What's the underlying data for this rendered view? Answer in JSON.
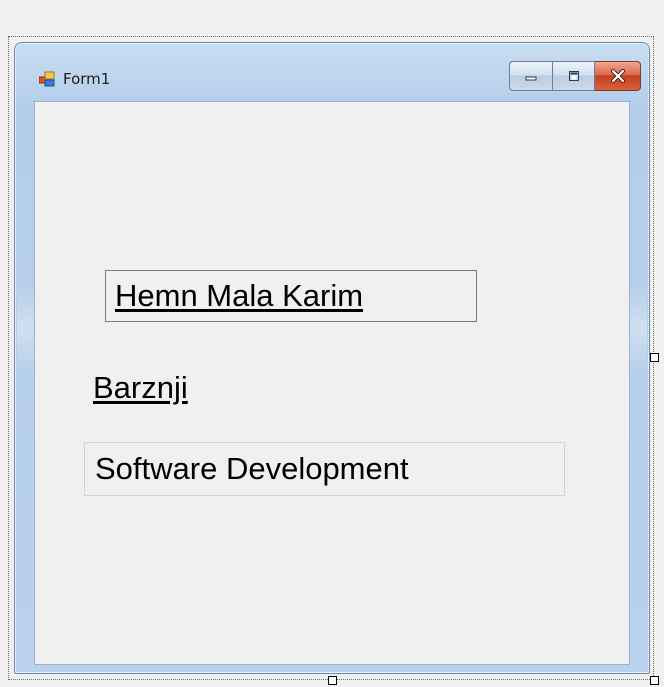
{
  "window": {
    "title": "Form1",
    "icon": "form-icon"
  },
  "caption_buttons": {
    "minimize": "minimize-icon",
    "maximize": "maximize-icon",
    "close": "close-icon"
  },
  "labels": {
    "name": "Hemn Mala Karim",
    "surname": "Barznji",
    "department": "Software Development"
  },
  "colors": {
    "window_frame": "#b9d1ec",
    "client_background": "#f0f0f0",
    "close_button": "#c4401f"
  }
}
